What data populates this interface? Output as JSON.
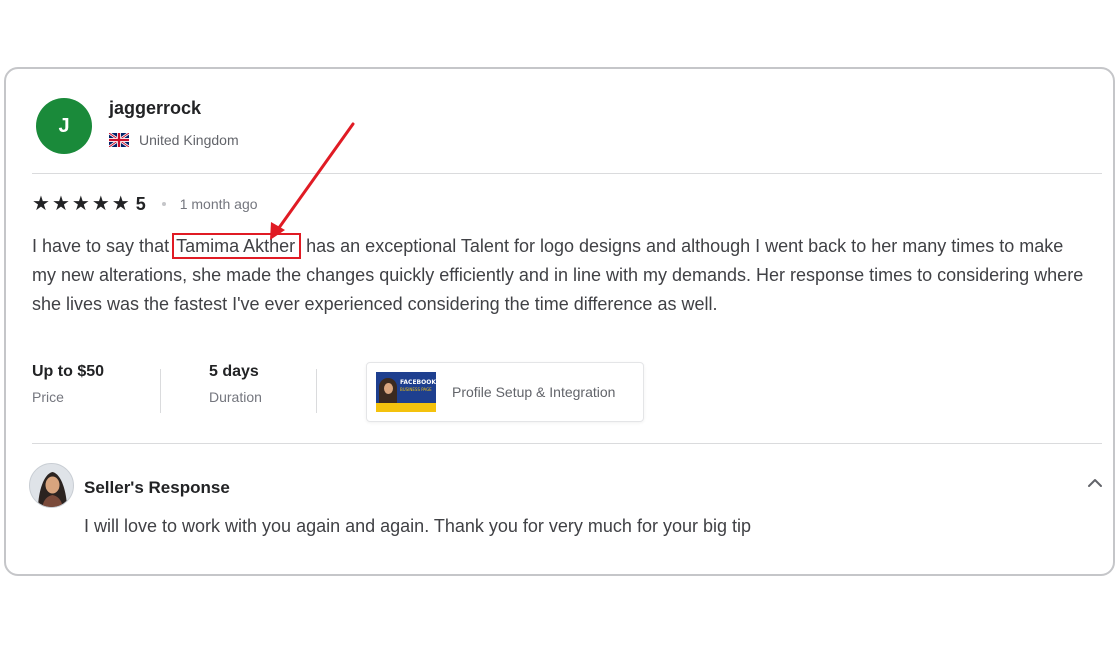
{
  "reviewer": {
    "initial": "J",
    "username": "jaggerrock",
    "country": "United Kingdom",
    "avatar_color": "#1a8a3a"
  },
  "rating": {
    "stars": 5,
    "score": "5",
    "time_ago": "1 month ago"
  },
  "review": {
    "before": "I have to say that ",
    "highlight": "Tamima Akther",
    "after": " has an exceptional Talent for logo designs and although I went back to her many times to make my new alterations, she made the changes quickly efficiently and in line with my demands. Her response times to considering where she lives was the fastest I've ever experienced considering the time difference as well."
  },
  "meta": {
    "price_value": "Up to $50",
    "price_label": "Price",
    "duration_value": "5 days",
    "duration_label": "Duration"
  },
  "gig": {
    "title": "Profile Setup & Integration",
    "thumb_text_1": "FACEBOOK",
    "thumb_text_2": "BUSINESS PAGE"
  },
  "seller_response": {
    "title": "Seller's Response",
    "text": "I will love to work with you again and again. Thank you for very much for your big tip"
  },
  "icons": {
    "star": "star-icon",
    "flag": "uk-flag-icon",
    "collapse": "chevron-up-icon"
  },
  "colors": {
    "annotation": "#e01b24",
    "star": "#222325"
  }
}
